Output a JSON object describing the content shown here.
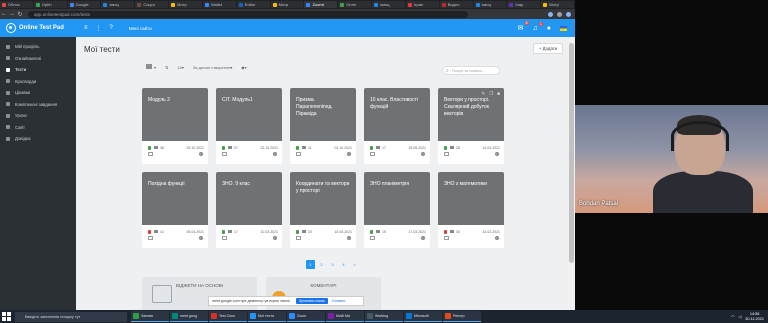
{
  "browser": {
    "tabs": [
      "Облос",
      "Opbh",
      "Google",
      "ємоц",
      "Соцсо",
      "Мотр",
      "Wallet",
      "Editor",
      "Мотр",
      "Zoomt",
      "Онлн",
      "ємоц",
      "Ігран",
      "Видео",
      "ємоц",
      "Ілар",
      "Мотр"
    ],
    "active_tab_index": 9,
    "tab_colors": [
      "#e8453c",
      "#34a853",
      "#4285f4",
      "#1e88e5",
      "#6d4c41",
      "#fbbc05",
      "#2d8cff",
      "#1565c0",
      "#fbbc05",
      "#2d8cff",
      "#43a047",
      "#1e88e5",
      "#e53935",
      "#c62828",
      "#1e88e5",
      "#5e35b1",
      "#fbbc05"
    ],
    "url": "app.onlinetestpad.com/tests"
  },
  "app": {
    "logo": "Online Test Pad",
    "header_link": "Мені сайти",
    "notif_count_1": "8",
    "notif_count_2": "1"
  },
  "sidebar": {
    "items": [
      {
        "label": "Мій профіль",
        "active": false
      },
      {
        "label": "Ознайомлені",
        "active": false
      },
      {
        "label": "Тести",
        "active": true
      },
      {
        "label": "Кросворди",
        "active": false
      },
      {
        "label": "Цікавки",
        "active": false
      },
      {
        "label": "Комплексні завдання",
        "active": false
      },
      {
        "label": "Уроки",
        "active": false
      },
      {
        "label": "Сайт",
        "active": false
      },
      {
        "label": "Довідка",
        "active": false
      }
    ]
  },
  "main": {
    "title": "Мої тести",
    "add_label": "+ Додати",
    "toolbar": {
      "count": "10",
      "sort": "За датою створення"
    },
    "search_placeholder": "Пошук за назвою..."
  },
  "cards": [
    {
      "title": "Модуль 2",
      "count": "36",
      "date": "29.10.2021",
      "lock": "green",
      "tools": false
    },
    {
      "title": "СІТ. Модуль1",
      "count": "37",
      "date": "22.10.2021",
      "lock": "green",
      "tools": false
    },
    {
      "title": "Призма. Паралелепіпед. Піраміда",
      "count": "11",
      "date": "01.10.2021",
      "lock": "green",
      "tools": false
    },
    {
      "title": "10 клас. Властивості функцій",
      "count": "17",
      "date": "15.05.2021",
      "lock": "green",
      "tools": false
    },
    {
      "title": "Вектори у просторі. Скалярний добуток векторів",
      "count": "28",
      "date": "14.04.2021",
      "lock": "green",
      "tools": true
    },
    {
      "title": "Похідна функції",
      "count": "41",
      "date": "05.04.2021",
      "lock": "red",
      "tools": false
    },
    {
      "title": "ЗНО. 9 клас",
      "count": "17",
      "date": "10.03.2021",
      "lock": "green",
      "tools": false
    },
    {
      "title": "Координати та вектори у просторі",
      "count": "20",
      "date": "10.03.2021",
      "lock": "green",
      "tools": false
    },
    {
      "title": "ЗНО планіметрія",
      "count": "15",
      "date": "17.03.2021",
      "lock": "green",
      "tools": false
    },
    {
      "title": "ЗНО з математики",
      "count": "30",
      "date": "15.02.2021",
      "lock": "red",
      "tools": false
    }
  ],
  "pager": [
    "1",
    "2",
    "3",
    "4",
    ">"
  ],
  "pager_active": 0,
  "widgets": {
    "w1_title": "ВІДЖЕТИ НА ОСНОВІ",
    "w2_title": "КОМЕНТАРІ"
  },
  "share_bar": {
    "text": "meet.google.com пре демонстр ув екран і вікно",
    "stop": "Зупинити показ",
    "hide": "Сховати"
  },
  "webcam": {
    "name": "Bohdan Patsai"
  },
  "taskbar": {
    "search": "Введіть запитання пошуку тут",
    "apps": [
      {
        "label": "Заповн",
        "color": "#2ea043"
      },
      {
        "label": "meet.goog",
        "color": "#00897b"
      },
      {
        "label": "Test Cons",
        "color": "#d93025"
      },
      {
        "label": "Мої тести",
        "color": "#2196f3"
      },
      {
        "label": "Zoom",
        "color": "#2d8cff"
      },
      {
        "label": "Мойі Ма",
        "color": "#7b1fa2"
      },
      {
        "label": "Working",
        "color": "#455a64"
      },
      {
        "label": "Microsoft",
        "color": "#0078d4"
      },
      {
        "label": "Реєстр",
        "color": "#e64a19"
      }
    ],
    "time": "14:58",
    "date": "30.11.2021"
  }
}
